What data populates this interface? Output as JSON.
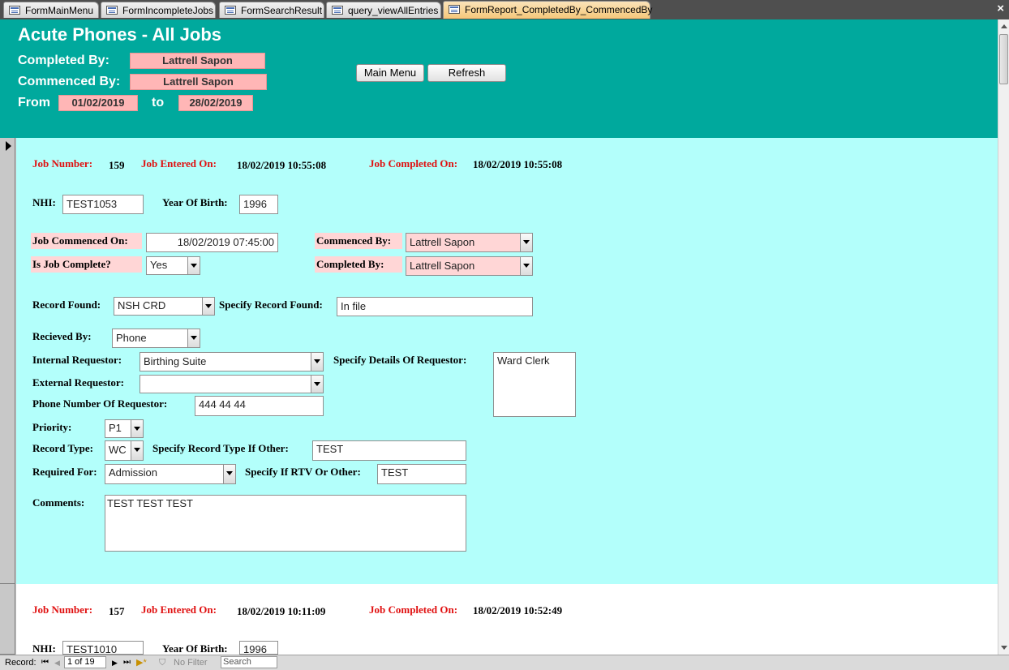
{
  "tabs": [
    {
      "label": "FormMainMenu"
    },
    {
      "label": "FormIncompleteJobs"
    },
    {
      "label": "FormSearchResult"
    },
    {
      "label": "query_viewAllEntries"
    },
    {
      "label": "FormReport_CompletedBy_CommencedBy"
    }
  ],
  "header": {
    "title": "Acute Phones - All Jobs",
    "completed_by_label": "Completed By:",
    "completed_by_value": "Lattrell Sapon",
    "commenced_by_label": "Commenced By:",
    "commenced_by_value": "Lattrell Sapon",
    "from_label": "From",
    "from_value": "01/02/2019",
    "to_label": "to",
    "to_value": "28/02/2019",
    "main_menu_button": "Main Menu",
    "refresh_button": "Refresh"
  },
  "labels": {
    "job_number": "Job Number:",
    "job_entered_on": "Job Entered On:",
    "job_completed_on": "Job Completed On:",
    "nhi": "NHI:",
    "year_of_birth": "Year Of Birth:",
    "job_commenced_on": "Job Commenced On:",
    "is_job_complete": "Is Job Complete?",
    "commenced_by": "Commenced By:",
    "completed_by": "Completed By:",
    "record_found": "Record Found:",
    "specify_record_found": "Specify Record Found:",
    "received_by": "Recieved By:",
    "internal_requestor": "Internal Requestor:",
    "specify_details_requestor": "Specify Details Of Requestor:",
    "external_requestor": "External Requestor:",
    "phone_number_requestor": "Phone Number Of Requestor:",
    "priority": "Priority:",
    "record_type": "Record Type:",
    "specify_record_type": "Specify Record Type If Other:",
    "required_for": "Required For:",
    "specify_rtv": "Specify If RTV Or Other:",
    "comments": "Comments:"
  },
  "records": [
    {
      "job_number": "159",
      "job_entered_on": "18/02/2019 10:55:08",
      "job_completed_on": "18/02/2019 10:55:08",
      "nhi": "TEST1053",
      "year_of_birth": "1996",
      "job_commenced_on": "18/02/2019 07:45:00",
      "is_job_complete": "Yes",
      "commenced_by": "Lattrell Sapon",
      "completed_by": "Lattrell Sapon",
      "record_found": "NSH CRD",
      "specify_record_found": "In file",
      "received_by": "Phone",
      "internal_requestor": "Birthing Suite",
      "specify_details_requestor": "Ward Clerk",
      "external_requestor": "",
      "phone_number_requestor": "444 44 44",
      "priority": "P1",
      "record_type": "WC",
      "specify_record_type": "TEST",
      "required_for": "Admission",
      "specify_rtv": "TEST",
      "comments": "TEST TEST TEST"
    },
    {
      "job_number": "157",
      "job_entered_on": "18/02/2019 10:11:09",
      "job_completed_on": "18/02/2019 10:52:49",
      "nhi": "TEST1010",
      "year_of_birth": "1996"
    }
  ],
  "statusbar": {
    "record_label": "Record:",
    "position": "1 of 19",
    "filter": "No Filter",
    "search": "Search"
  }
}
